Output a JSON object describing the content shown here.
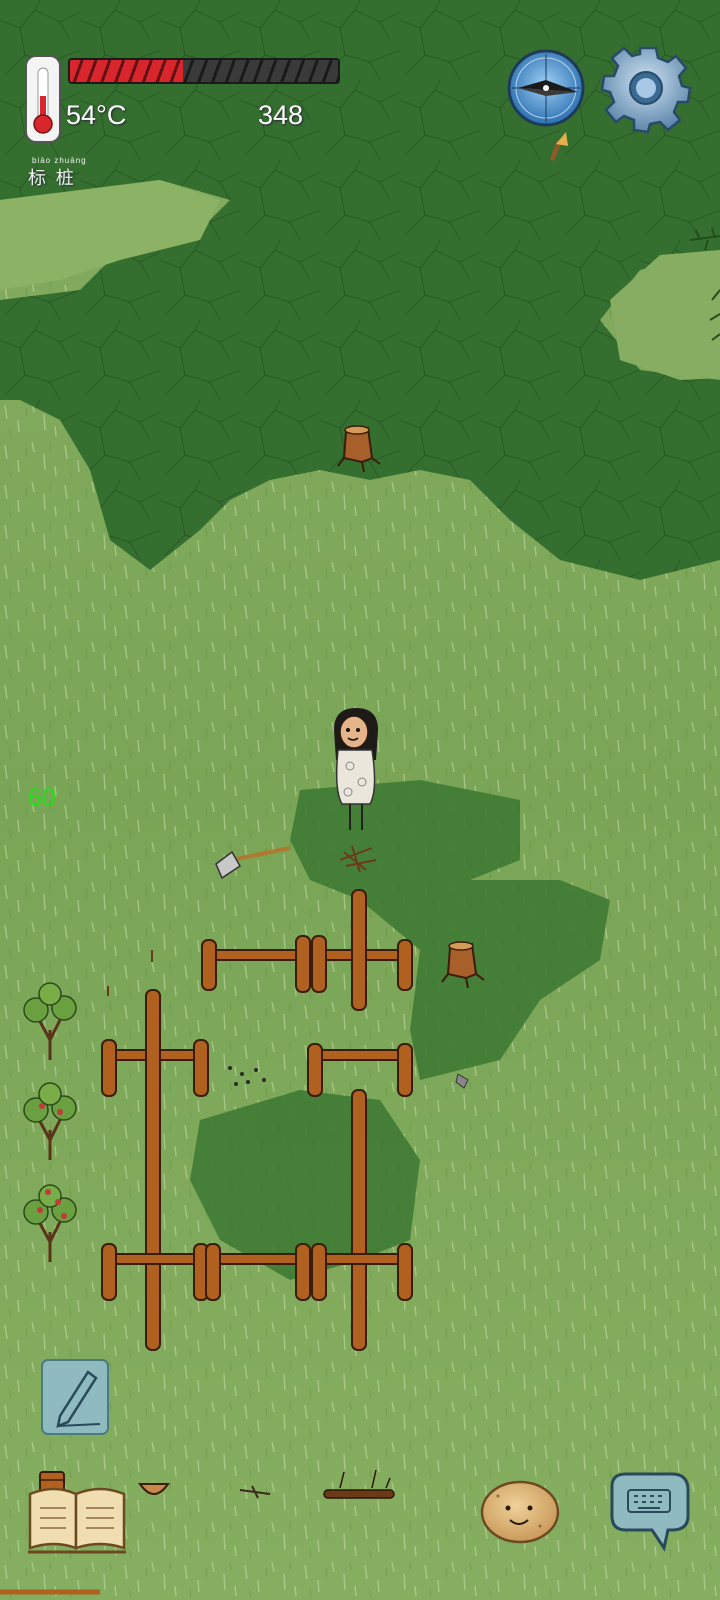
{
  "hud": {
    "temperature": "54°C",
    "score": "348",
    "health_fraction": 0.42,
    "label_pinyin": "biāo zhuāng",
    "label_hanzi": "标 桩",
    "fps": "60"
  },
  "icons": {
    "thermometer": "thermometer-icon",
    "compass": "compass-icon",
    "settings": "gear-icon",
    "pencil": "pencil-icon",
    "journal": "open-book-icon",
    "companion": "potato-face-icon",
    "chat": "keyboard-chat-icon"
  },
  "colors": {
    "health": "#d8262c",
    "grass": "#7ea85a",
    "forest": "#2f6a2a",
    "wood": "#a0561c",
    "fps": "#22e01a"
  }
}
